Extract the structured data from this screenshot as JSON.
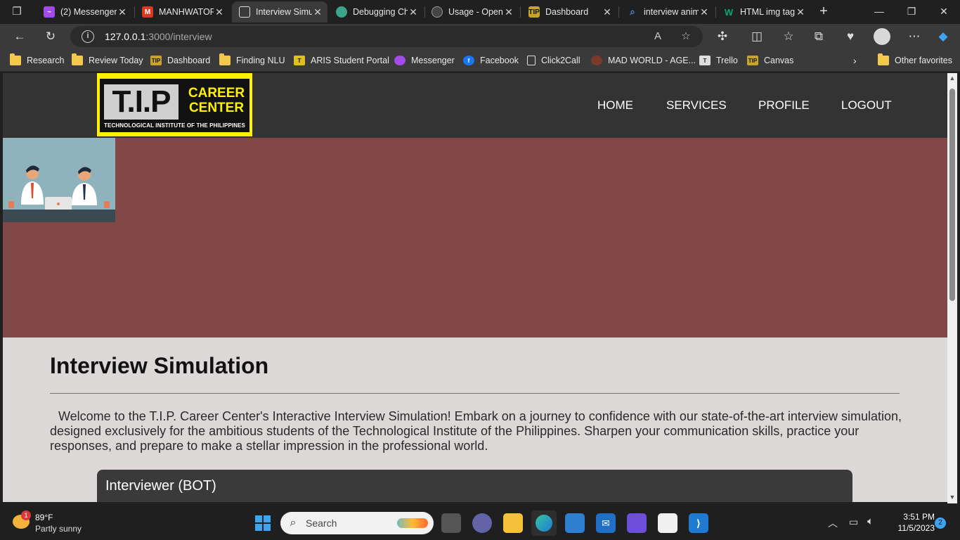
{
  "browser": {
    "tabs": [
      {
        "title": "(2) Messenger",
        "favicon_color": "#a24bea",
        "active": false
      },
      {
        "title": "MANHWATOP",
        "favicon_color": "#d9391e",
        "active": false
      },
      {
        "title": "Interview Simulation",
        "favicon_color": "#ffffff",
        "active": true
      },
      {
        "title": "Debugging Ch",
        "favicon_color": "#3aa58a",
        "active": false
      },
      {
        "title": "Usage - OpenAI",
        "favicon_color": "#333333",
        "active": false
      },
      {
        "title": "Dashboard",
        "favicon_color": "#c8a52a",
        "active": false
      },
      {
        "title": "interview anim",
        "favicon_color": "#2b78e4",
        "active": false
      },
      {
        "title": "HTML img tag",
        "favicon_color": "#04aa6d",
        "active": false
      }
    ],
    "address": {
      "host": "127.0.0.1",
      "path": ":3000/interview"
    },
    "favorites": [
      {
        "label": "Research",
        "type": "folder"
      },
      {
        "label": "Review Today",
        "type": "folder"
      },
      {
        "label": "Dashboard",
        "type": "site"
      },
      {
        "label": "Finding NLU",
        "type": "folder"
      },
      {
        "label": "ARIS Student Portal",
        "type": "site"
      },
      {
        "label": "Messenger",
        "type": "site"
      },
      {
        "label": "Facebook",
        "type": "site"
      },
      {
        "label": "Click2Call",
        "type": "site"
      },
      {
        "label": "MAD WORLD - AGE...",
        "type": "site"
      },
      {
        "label": "Trello",
        "type": "site"
      },
      {
        "label": "Canvas",
        "type": "site"
      }
    ],
    "other_favorites": "Other favorites"
  },
  "site": {
    "logo": {
      "big": "T.I.P",
      "career": "CAREER",
      "center": "CENTER",
      "sub": "TECHNOLOGICAL INSTITUTE OF THE PHILIPPINES"
    },
    "nav": [
      "HOME",
      "SERVICES",
      "PROFILE",
      "LOGOUT"
    ],
    "page_title": "Interview Simulation",
    "intro": "Welcome to the T.I.P. Career Center's Interactive Interview Simulation! Embark on a journey to confidence with our state-of-the-art interview simulation, designed exclusively for the ambitious students of the Technological Institute of the Philippines. Sharpen your communication skills, practice your responses, and prepare to make a stellar impression in the professional world.",
    "chat_header": "Interviewer (BOT)",
    "colors": {
      "header": "#333333",
      "hero": "#824848",
      "content_bg": "#dcd8d7",
      "logo_yellow": "#fff200"
    }
  },
  "taskbar": {
    "weather": {
      "temp": "89°F",
      "desc": "Partly sunny",
      "badge": "1"
    },
    "search_label": "Search",
    "time": "3:51 PM",
    "date": "11/5/2023",
    "notifications": "2"
  }
}
